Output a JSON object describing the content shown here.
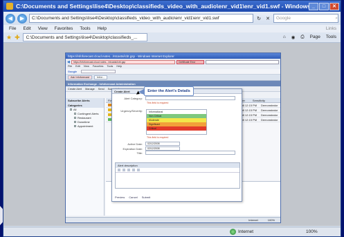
{
  "outer_window": {
    "title": "C:\\Documents and Settings\\lise4\\Desktop\\classifieds_video_with_audio\\enr_vid1\\enr_vid1.swf - Windows Internet Explorer pro...",
    "address": "C:\\Documents and Settings\\lise4\\Desktop\\classifieds_video_with_audio\\enr_vid1\\enr_vid1.swf",
    "search_placeholder": "Google",
    "menu": [
      "File",
      "Edit",
      "View",
      "Favorites",
      "Tools",
      "Help"
    ],
    "menu_right": "Links",
    "tab_label": "C:\\Documents and Settings\\lise4\\Desktop\\classifieds_...",
    "tools": [
      "Page",
      "Tools"
    ],
    "status_zone": "Internet",
    "zoom": "100%"
  },
  "inner_window": {
    "title": "https://infoforecast.cloud.notes.../ntcasts/icbt.gsp - Windows Internet Explorer",
    "url": "https://infoforecast.cloud.notes.../ntcasts/icbt.gsp",
    "cert": "Certificate Error",
    "menu": [
      "File",
      "Edit",
      "View",
      "Favorites",
      "Tools",
      "Help"
    ],
    "google_label": "Google",
    "tabs": [
      "Ask Infoforecast",
      "Infor..."
    ],
    "app_header": "Information Exchange - Infoforecast Administration",
    "toolbar": [
      "Create Alert",
      "Manage",
      "Send",
      "Subscriptions"
    ],
    "left_items": [
      "Subscribe Alerts",
      "Categories",
      "All",
      "Contingent Alerts",
      "Restaurant",
      "Downtime",
      "Appointment"
    ],
    "grid_headers": [
      "Flags",
      "Category",
      "Sender",
      "Sensitivity"
    ],
    "grid_rows": [
      {
        "flag": "#e08a1a",
        "date": "2/26/2008 12:15 PM",
        "who": "Demonstrator"
      },
      {
        "flag": "#e3b51a",
        "date": "2/26/2008 12:15 PM",
        "who": "Demonstrator"
      },
      {
        "flag": "#e3b51a",
        "date": "2/26/2008 12:15 PM",
        "who": "Demonstrator"
      },
      {
        "flag": "#5cb85c",
        "date": "2/26/2008 12:15 PM",
        "who": "Demonstrator"
      }
    ],
    "status_right": [
      "Internet",
      "100%"
    ]
  },
  "dialog": {
    "title": "Create Alert",
    "labels": {
      "alert_category": "Alert Category:",
      "severity": "Urgency/Severity:",
      "alert_title": "Title:",
      "start_date": "Active Date:",
      "end_date": "Expiration Date:"
    },
    "required": "This field is required",
    "severity_levels": [
      {
        "label": "Informational",
        "color": "#ffffff"
      },
      {
        "label": "Non-Critical",
        "color": "#7ec87e"
      },
      {
        "label": "Moderate",
        "color": "#f2e64a"
      },
      {
        "label": "Significant",
        "color": "#f2a03a"
      },
      {
        "label": "Critical",
        "color": "#e33a2a"
      }
    ],
    "start_date": "02/12/2008",
    "end_date": "02/12/2008",
    "editor_label": "Alert description",
    "buttons": [
      "Preview",
      "Cancel",
      "Submit"
    ]
  },
  "callout": "Enter the Alert's Details",
  "colors": {
    "title_bar": "#1c48ad",
    "desktop": "#0a22a8"
  }
}
